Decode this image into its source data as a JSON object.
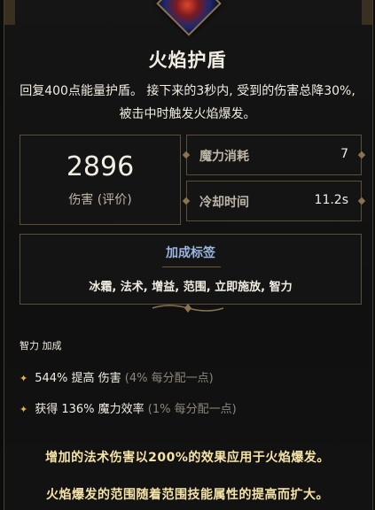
{
  "skill": {
    "title": "火焰护盾",
    "description": "回复400点能量护盾。 接下来的3秒内, 受到的伤害总降30%, 被击中时触发火焰爆发。"
  },
  "damage": {
    "value": "2896",
    "label": "伤害 (评价)"
  },
  "stats": [
    {
      "label": "魔力消耗",
      "value": "7"
    },
    {
      "label": "冷却时间",
      "value": "11.2s"
    }
  ],
  "tags": {
    "title": "加成标签",
    "list": "冰霜, 法术, 增益, 范围, 立即施放, 智力"
  },
  "attribute_bonus": {
    "header": "智力 加成",
    "rows": [
      {
        "main": "544% 提高 伤害",
        "note": "(4% 每分配一点)"
      },
      {
        "main": "获得 136% 魔力效率",
        "note": "(1% 每分配一点)"
      }
    ]
  },
  "notices": [
    "增加的法术伤害以200%的效果应用于火焰爆发。",
    "火焰爆发的范围随着范围技能属性的提高而扩大。"
  ],
  "colors": {
    "accent": "#8a7350",
    "tag_title": "#9bb6e0",
    "notice": "#f6e3a8",
    "sparkle": "#e8b24a"
  }
}
